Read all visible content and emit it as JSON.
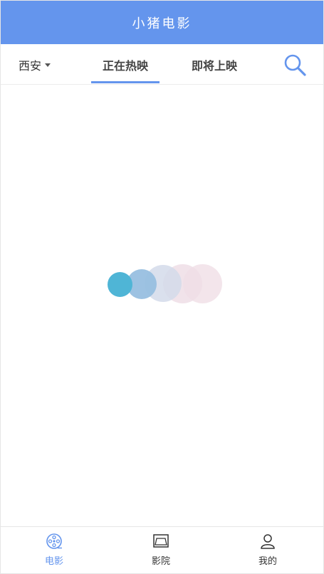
{
  "header": {
    "title": "小猪电影"
  },
  "subnav": {
    "city": "西安",
    "tabs": [
      {
        "label": "正在热映",
        "active": true
      },
      {
        "label": "即将上映",
        "active": false
      }
    ],
    "search_icon": "search-icon"
  },
  "loading": {
    "icon": "loading-dots",
    "colors": [
      "#4fb5d6",
      "#98bfe0",
      "#d3daea",
      "#eedee6",
      "#f2e2e9"
    ]
  },
  "tabbar": {
    "items": [
      {
        "label": "电影",
        "icon": "film-reel-icon",
        "active": true
      },
      {
        "label": "影院",
        "icon": "cinema-screen-icon",
        "active": false
      },
      {
        "label": "我的",
        "icon": "user-icon",
        "active": false
      }
    ]
  },
  "colors": {
    "accent": "#6495ed",
    "text": "#333333"
  }
}
